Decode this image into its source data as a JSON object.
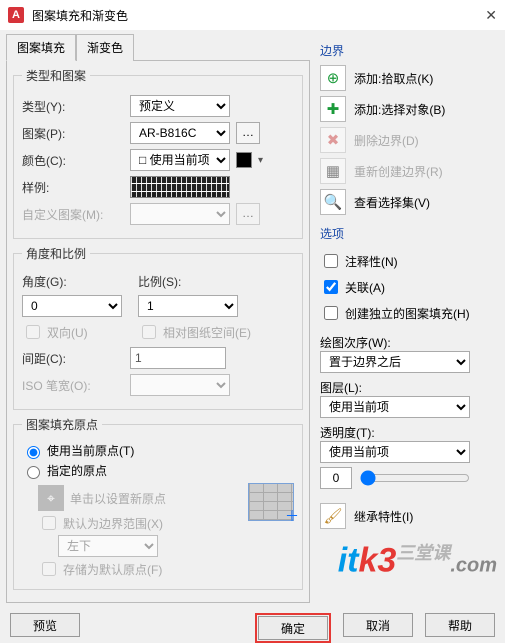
{
  "window": {
    "title": "图案填充和渐变色",
    "logo_letter": "A"
  },
  "tabs": {
    "fill": "图案填充",
    "gradient": "渐变色"
  },
  "type_pattern": {
    "legend": "类型和图案",
    "type_label": "类型(Y):",
    "type_value": "预定义",
    "pattern_label": "图案(P):",
    "pattern_value": "AR-B816C",
    "color_label": "颜色(C):",
    "color_option": "使用当前项",
    "sample_label": "样例:",
    "custom_label": "自定义图案(M):"
  },
  "angle_scale": {
    "legend": "角度和比例",
    "angle_label": "角度(G):",
    "angle_value": "0",
    "scale_label": "比例(S):",
    "scale_value": "1",
    "double_label": "双向(U)",
    "relpaper_label": "相对图纸空间(E)",
    "spacing_label": "间距(C):",
    "spacing_value": "1",
    "iso_label": "ISO 笔宽(O):"
  },
  "origin": {
    "legend": "图案填充原点",
    "use_current": "使用当前原点(T)",
    "specified": "指定的原点",
    "click_new": "单击以设置新原点",
    "default_bound": "默认为边界范围(X)",
    "pos_value": "左下",
    "store_default": "存储为默认原点(F)"
  },
  "boundary": {
    "title": "边界",
    "pick_point": "添加:拾取点(K)",
    "select_obj": "添加:选择对象(B)",
    "remove": "删除边界(D)",
    "recreate": "重新创建边界(R)",
    "viewsel": "查看选择集(V)"
  },
  "options": {
    "title": "选项",
    "annotative": "注释性(N)",
    "assoc": "关联(A)",
    "independent": "创建独立的图案填充(H)",
    "draworder_label": "绘图次序(W):",
    "draworder_value": "置于边界之后",
    "layer_label": "图层(L):",
    "layer_value": "使用当前项",
    "trans_label": "透明度(T):",
    "trans_select": "使用当前项",
    "trans_num": "0",
    "inherit": "继承特性(I)"
  },
  "buttons": {
    "preview": "预览",
    "ok": "确定",
    "cancel": "取消",
    "help": "帮助"
  },
  "watermark": {
    "t1": "it",
    "t2": "k3",
    "t3": ".com",
    "t4": "三堂课"
  }
}
